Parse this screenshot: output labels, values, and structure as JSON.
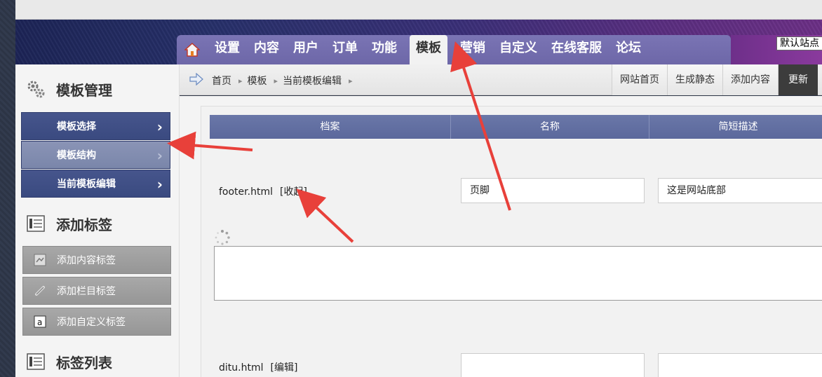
{
  "nav": {
    "items": [
      "设置",
      "内容",
      "用户",
      "订单",
      "功能",
      "模板",
      "营销",
      "自定义",
      "在线客服",
      "论坛"
    ],
    "active": "模板",
    "site_badge": "默认站点"
  },
  "sidebar": {
    "sections": [
      {
        "title": "模板管理",
        "icon": "gears-icon"
      },
      {
        "title": "添加标签",
        "icon": "list-icon"
      },
      {
        "title": "标签列表",
        "icon": "list-icon"
      }
    ],
    "template_items": [
      {
        "label": "模板选择",
        "selected": false
      },
      {
        "label": "模板结构",
        "selected": true
      },
      {
        "label": "当前模板编辑",
        "selected": false
      }
    ],
    "tag_items": [
      {
        "label": "添加内容标签",
        "icon": "document-icon"
      },
      {
        "label": "添加栏目标签",
        "icon": "link-icon"
      },
      {
        "label": "添加自定义标签",
        "icon": "a-badge-icon"
      }
    ]
  },
  "breadcrumb": {
    "items": [
      "首页",
      "模板",
      "当前模板编辑"
    ]
  },
  "actions": [
    "网站首页",
    "生成静态",
    "添加内容",
    "更新"
  ],
  "table": {
    "headers": [
      "档案",
      "名称",
      "简短描述"
    ],
    "rows": [
      {
        "file": "footer.html",
        "toggle": "[收起]",
        "name": "页脚",
        "desc": "这是网站底部"
      },
      {
        "file": "ditu.html",
        "toggle": "[编辑]",
        "name": "",
        "desc": ""
      }
    ]
  },
  "colors": {
    "accent": "#3a4a80",
    "annotation_arrow": "#e8403a"
  }
}
